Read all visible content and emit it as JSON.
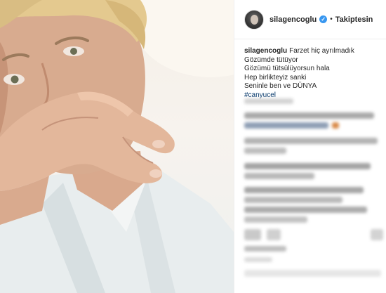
{
  "header": {
    "username": "silagencoglu",
    "separator": "•",
    "follow_label": "Takiptesin",
    "verified_icon": "verified-badge-icon",
    "verified_color": "#3897f0"
  },
  "caption": {
    "username": "silagencoglu",
    "lines": [
      "Farzet hiç ayrılmadık",
      "Gözümde tütüyor",
      "Gözümü tütsülüyorsun hala",
      "Hep birlikteyiz sanki",
      "Seninle ben ve DÜNYA"
    ],
    "hashtag": "#canyucel"
  },
  "colors": {
    "hashtag": "#003569",
    "text": "#262626",
    "border": "#efefef"
  }
}
